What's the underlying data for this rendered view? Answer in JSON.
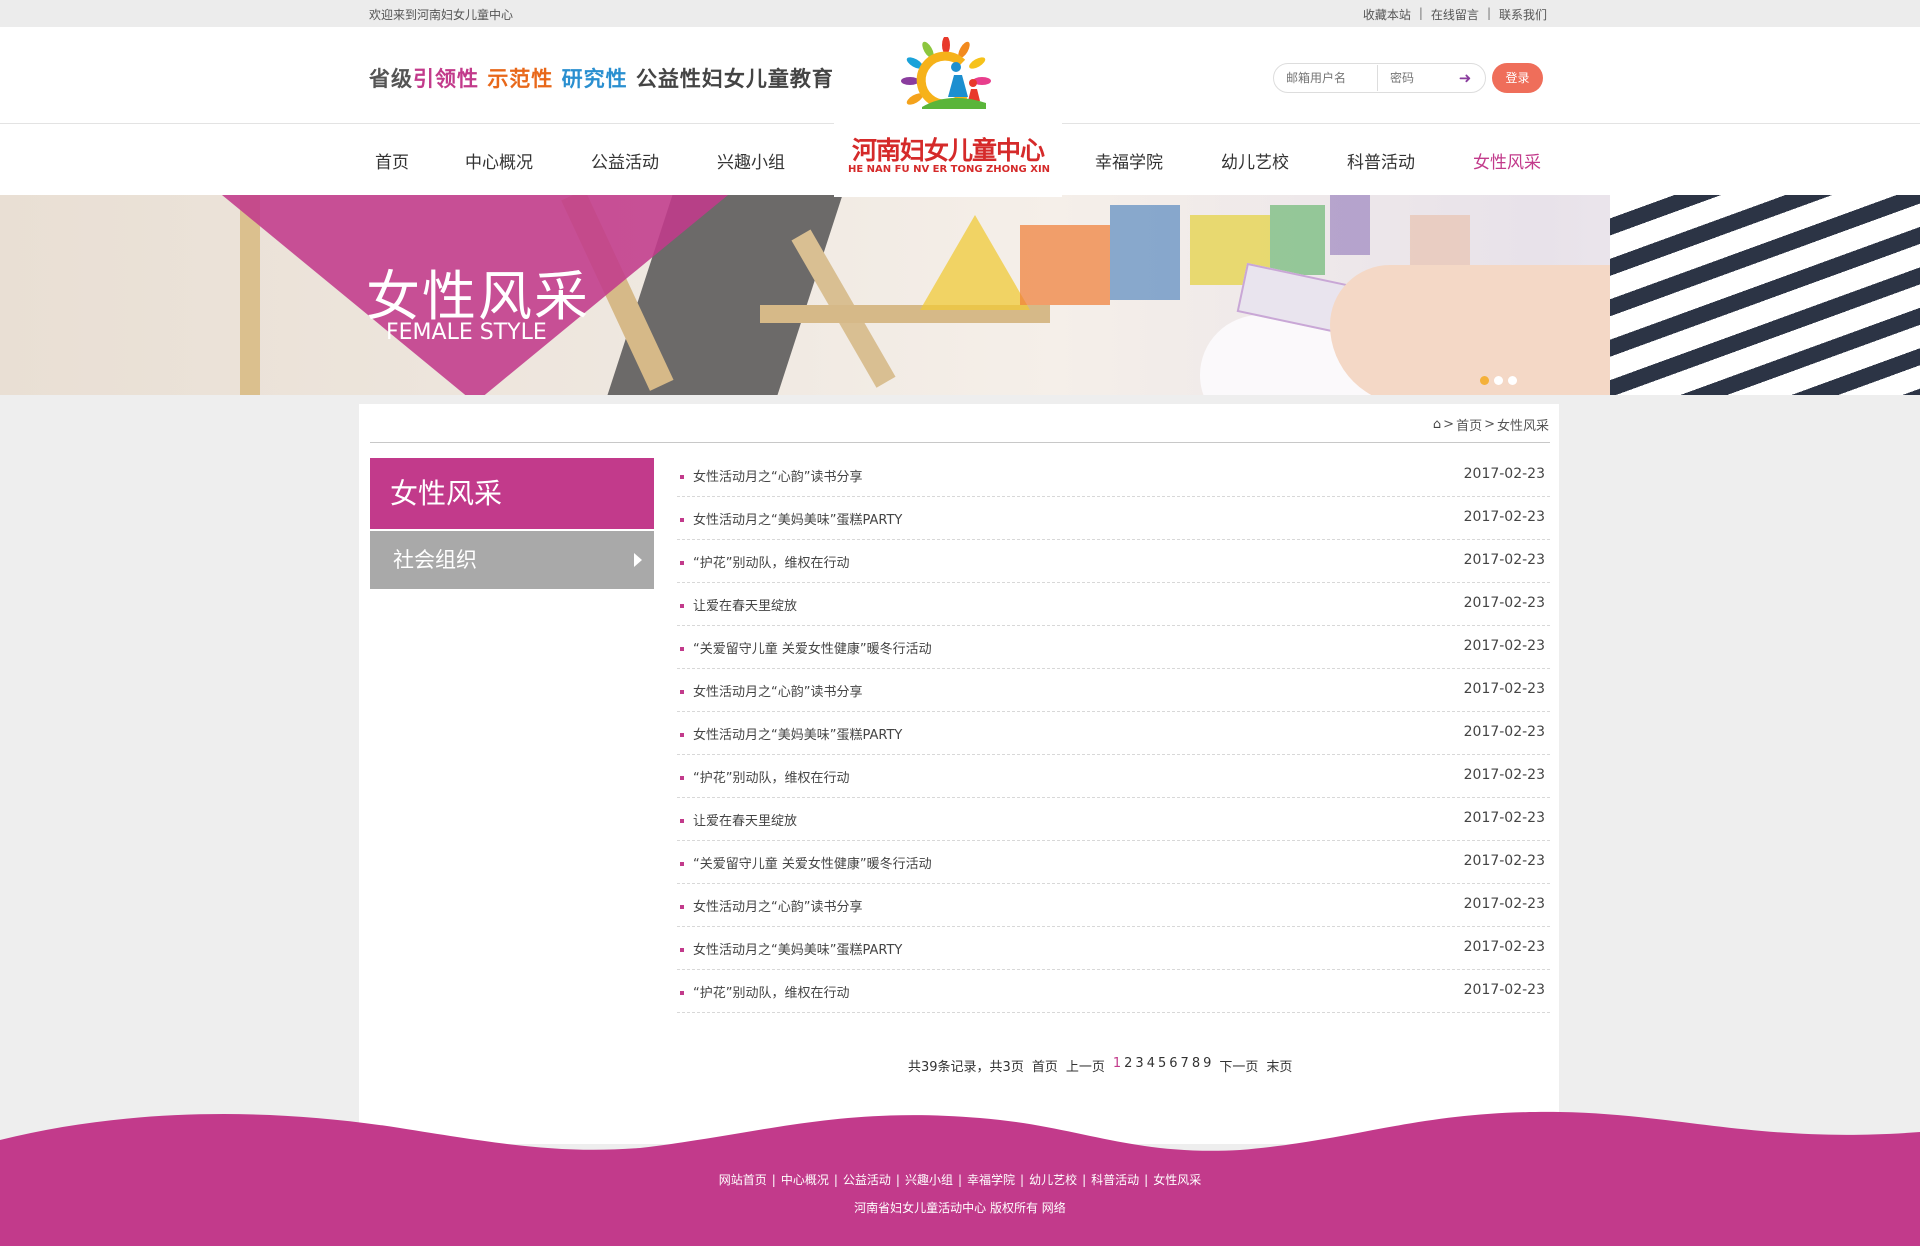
{
  "topbar": {
    "welcome": "欢迎来到河南妇女儿童中心",
    "links": [
      "收藏本站",
      "在线留言",
      "联系我们"
    ]
  },
  "header": {
    "slogan": [
      "省级",
      "引领性",
      "示范性",
      "研究性",
      "公益性妇女儿童教育阵地"
    ],
    "username_placeholder": "邮箱用户名",
    "password_placeholder": "密码",
    "login_label": "登录"
  },
  "logo": {
    "cn": "河南妇女儿童中心",
    "en": "HE NAN FU NV ER TONG  ZHONG XIN"
  },
  "nav": {
    "items": [
      "首页",
      "中心概况",
      "公益活动",
      "兴趣小组",
      "幸福学院",
      "幼儿艺校",
      "科普活动",
      "女性风采"
    ],
    "active": "女性风采"
  },
  "banner": {
    "title_cn": "女性风采",
    "title_en": "FEMALE STYLE"
  },
  "breadcrumb": {
    "home": "首页",
    "current": "女性风采"
  },
  "sidebar": {
    "title": "女性风采",
    "items": [
      "社会组织"
    ]
  },
  "articles": [
    {
      "title": "女性活动月之“心韵”读书分享",
      "date": "2017-02-23"
    },
    {
      "title": "女性活动月之“美妈美味”蛋糕PARTY",
      "date": "2017-02-23"
    },
    {
      "title": "“护花”别动队，维权在行动",
      "date": "2017-02-23"
    },
    {
      "title": "让爱在春天里绽放",
      "date": "2017-02-23"
    },
    {
      "title": "“关爱留守儿童 关爱女性健康”暖冬行活动",
      "date": "2017-02-23"
    },
    {
      "title": "女性活动月之“心韵”读书分享",
      "date": "2017-02-23"
    },
    {
      "title": "女性活动月之“美妈美味”蛋糕PARTY",
      "date": "2017-02-23"
    },
    {
      "title": "“护花”别动队，维权在行动",
      "date": "2017-02-23"
    },
    {
      "title": "让爱在春天里绽放",
      "date": "2017-02-23"
    },
    {
      "title": "“关爱留守儿童 关爱女性健康”暖冬行活动",
      "date": "2017-02-23"
    },
    {
      "title": "女性活动月之“心韵”读书分享",
      "date": "2017-02-23"
    },
    {
      "title": "女性活动月之“美妈美味”蛋糕PARTY",
      "date": "2017-02-23"
    },
    {
      "title": "“护花”别动队，维权在行动",
      "date": "2017-02-23"
    }
  ],
  "pager": {
    "summary": "共39条记录，共3页",
    "first": "首页",
    "prev": "上一页",
    "pages": [
      "1",
      "2",
      "3",
      "4",
      "5",
      "6",
      "7",
      "8",
      "9"
    ],
    "current": "1",
    "next": "下一页",
    "last": "末页"
  },
  "footer": {
    "links": [
      "网站首页",
      "中心概况",
      "公益活动",
      "兴趣小组",
      "幸福学院",
      "幼儿艺校",
      "科普活动",
      "女性风采"
    ],
    "copyright": "河南省妇女儿童活动中心  版权所有    网络"
  },
  "colors": {
    "brand_pink": "#c23a8b",
    "login_orange": "#ef6e5a",
    "sidebar_gray": "#a9a9a9",
    "logo_red": "#d52a2a"
  }
}
